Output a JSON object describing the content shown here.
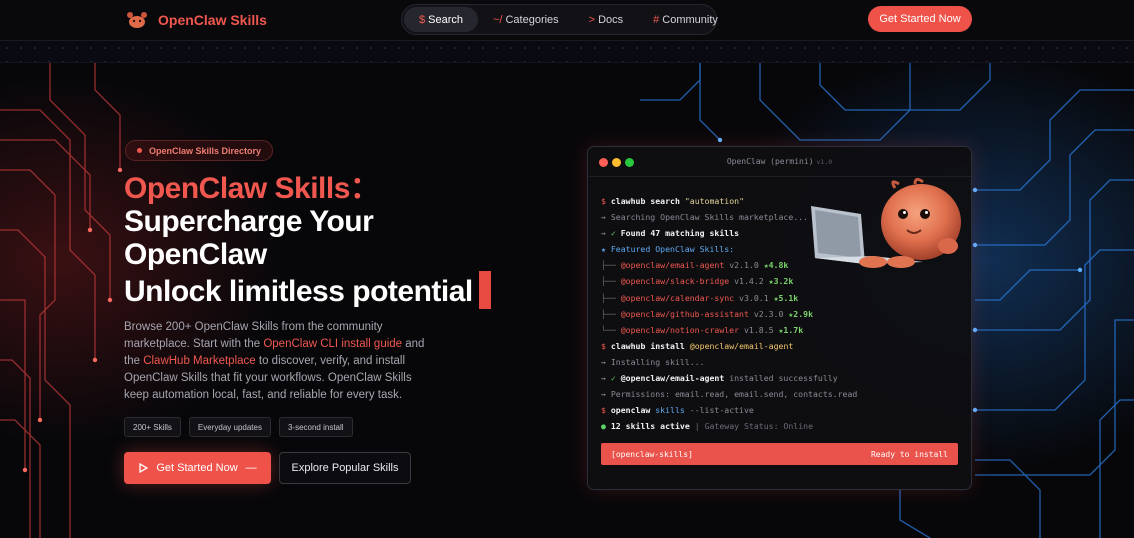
{
  "nav": {
    "brand": "OpenClaw Skills",
    "items": [
      {
        "symbol": "$",
        "label": "Search",
        "active": true
      },
      {
        "symbol": "~/",
        "label": "Categories",
        "active": false
      },
      {
        "symbol": ">",
        "label": "Docs",
        "active": false
      },
      {
        "symbol": "#",
        "label": "Community",
        "active": false
      }
    ],
    "cta": "Get Started Now"
  },
  "hero": {
    "badge": "OpenClaw Skills Directory",
    "headline_red": "OpenClaw Skills",
    "headline_colon": "：",
    "headline_line2": "Supercharge Your",
    "headline_line3": "OpenClaw",
    "headline_line4": "Unlock limitless potential",
    "desc_1": "Browse 200+ OpenClaw Skills from the community marketplace. Start with the ",
    "link_cli": "OpenClaw CLI install guide",
    "desc_2": " and the ",
    "link_hub": "ClawHub Marketplace",
    "desc_3": " to discover, verify, and install OpenClaw Skills that fit your workflows. OpenClaw Skills keep automation local, fast, and reliable for every task.",
    "stats": [
      "200+ Skills",
      "Everyday updates",
      "3-second install"
    ],
    "primary_button": "Get Started Now",
    "primary_arrow": "—",
    "secondary_button": "Explore Popular Skills"
  },
  "terminal": {
    "title": "OpenClaw (permini)",
    "version": "v1.0",
    "cmd1_prompt": "$",
    "cmd1_bin": "clawhub",
    "cmd1_sub": "search",
    "cmd1_arg": "\"automation\"",
    "out1": "→ Searching OpenClaw Skills marketplace...",
    "out2_prefix": "→",
    "out2_check": "✓",
    "out2_text": "Found 47 matching skills",
    "featured": "★ Featured OpenClaw Skills:",
    "skills": [
      {
        "tree": "├──",
        "name": "@openclaw/email-agent",
        "version": "v2.1.0",
        "stars": "★4.8k"
      },
      {
        "tree": "├──",
        "name": "@openclaw/slack-bridge",
        "version": "v1.4.2",
        "stars": "★3.2k"
      },
      {
        "tree": "├──",
        "name": "@openclaw/calendar-sync",
        "version": "v3.0.1",
        "stars": "★5.1k"
      },
      {
        "tree": "├──",
        "name": "@openclaw/github-assistant",
        "version": "v2.3.0",
        "stars": "★2.9k"
      },
      {
        "tree": "└──",
        "name": "@openclaw/notion-crawler",
        "version": "v1.8.5",
        "stars": "★1.7k"
      }
    ],
    "cmd2_prompt": "$",
    "cmd2_bin": "clawhub",
    "cmd2_sub": "install",
    "cmd2_arg": "@openclaw/email-agent",
    "out3": "→ Installing skill...",
    "out4_prefix": "→",
    "out4_check": "✓",
    "out4_name": "@openclaw/email-agent",
    "out4_text": " installed successfully",
    "out5": "→ Permissions: email.read, email.send, contacts.read",
    "cmd3_prompt": "$",
    "cmd3_bin": "openclaw",
    "cmd3_sub": "skills",
    "cmd3_flag": "--list-active",
    "status_dot": "●",
    "status_active": "12 skills active",
    "status_sep": "|",
    "status_gateway": "Gateway Status: Online",
    "footer_left": "[openclaw-skills]",
    "footer_right": "Ready to install"
  },
  "colors": {
    "accent": "#f0584f",
    "blue_glow": "#2a8cff",
    "background": "#07070a"
  }
}
